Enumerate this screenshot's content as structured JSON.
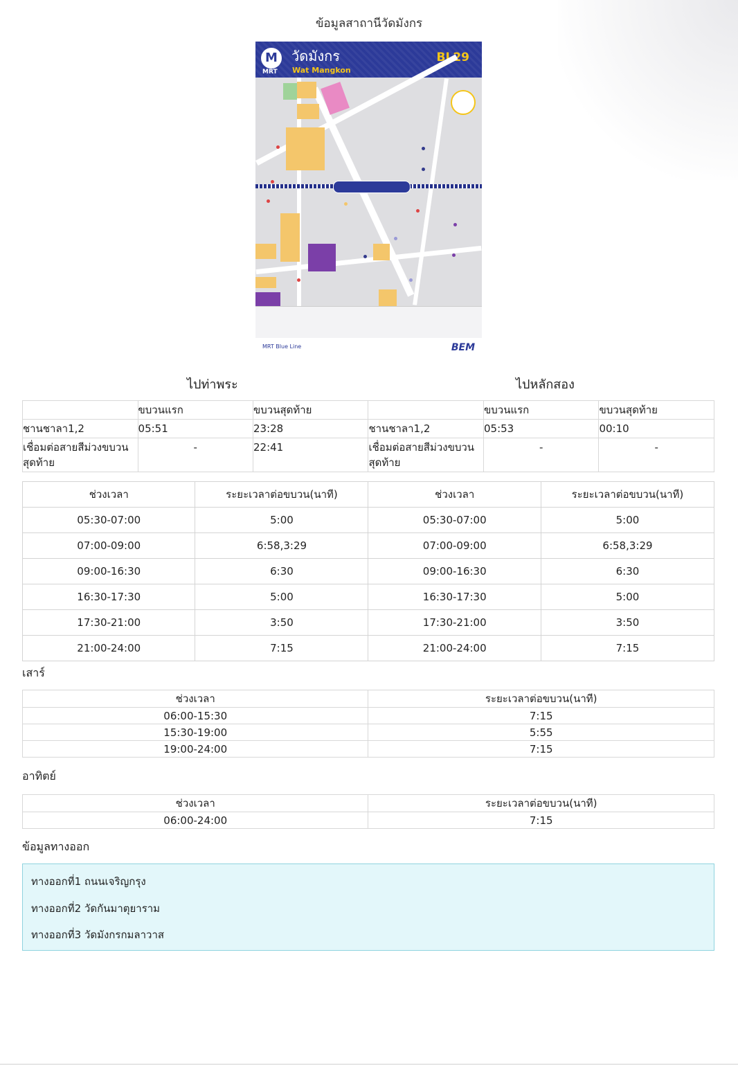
{
  "page_title": "ข้อมูลสาถานีวัดมังกร",
  "map": {
    "logo_letter": "M",
    "logo_text": "MRT",
    "station_name_th": "วัดมังกร",
    "station_name_en": "Wat Mangkon",
    "station_code": "BL29",
    "line_name": "MRT Blue Line",
    "operator": "BEM"
  },
  "direction_left": "ไปท่าพระ",
  "direction_right": "ไปหลักสอง",
  "first_last": {
    "headers": {
      "first": "ขบวนแรก",
      "last": "ขบวนสุดท้าย"
    },
    "left": [
      {
        "label": "ชานชาลา1,2",
        "first": "05:51",
        "last": "23:28"
      },
      {
        "label": "เชื่อมต่อสายสีม่วงขบวนสุดท้าย",
        "first": "-",
        "last": "22:41"
      }
    ],
    "right": [
      {
        "label": "ชานชาลา1,2",
        "first": "05:53",
        "last": "00:10"
      },
      {
        "label": "เชื่อมต่อสายสีม่วงขบวนสุดท้าย",
        "first": "-",
        "last": "-"
      }
    ]
  },
  "weekday": {
    "headers": {
      "period": "ช่วงเวลา",
      "interval": "ระยะเวลาต่อขบวน(นาที)"
    },
    "rows": [
      {
        "left_period": "05:30-07:00",
        "left_interval": "5:00",
        "right_period": "05:30-07:00",
        "right_interval": "5:00"
      },
      {
        "left_period": "07:00-09:00",
        "left_interval": "6:58,3:29",
        "right_period": "07:00-09:00",
        "right_interval": "6:58,3:29"
      },
      {
        "left_period": "09:00-16:30",
        "left_interval": "6:30",
        "right_period": "09:00-16:30",
        "right_interval": "6:30"
      },
      {
        "left_period": "16:30-17:30",
        "left_interval": "5:00",
        "right_period": "16:30-17:30",
        "right_interval": "5:00"
      },
      {
        "left_period": "17:30-21:00",
        "left_interval": "3:50",
        "right_period": "17:30-21:00",
        "right_interval": "3:50"
      },
      {
        "left_period": "21:00-24:00",
        "left_interval": "7:15",
        "right_period": "21:00-24:00",
        "right_interval": "7:15"
      }
    ]
  },
  "saturday": {
    "label": "เสาร์",
    "headers": {
      "period": "ช่วงเวลา",
      "interval": "ระยะเวลาต่อขบวน(นาที)"
    },
    "rows": [
      {
        "period": "06:00-15:30",
        "interval": "7:15"
      },
      {
        "period": "15:30-19:00",
        "interval": "5:55"
      },
      {
        "period": "19:00-24:00",
        "interval": "7:15"
      }
    ]
  },
  "sunday": {
    "label": "อาทิตย์",
    "headers": {
      "period": "ช่วงเวลา",
      "interval": "ระยะเวลาต่อขบวน(นาที)"
    },
    "rows": [
      {
        "period": "06:00-24:00",
        "interval": "7:15"
      }
    ]
  },
  "exits": {
    "label": "ข้อมูลทางออก",
    "items": [
      "ทางออกที่1 ถนนเจริญกรุง",
      "ทางออกที่2 วัดกันมาตุยาราม",
      "ทางออกที่3 วัดมังกรกมลาวาส"
    ]
  },
  "colors": {
    "map_header": "#2c3a99",
    "station_accent": "#f5c518",
    "exit_box_bg": "#e3f7fa",
    "exit_box_border": "#8fd3df"
  }
}
